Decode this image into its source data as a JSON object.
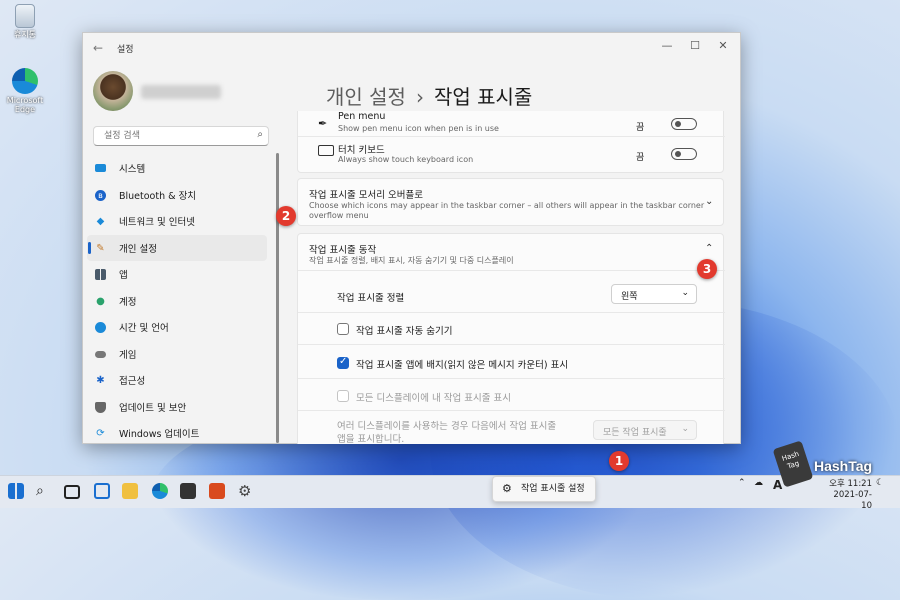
{
  "desktop": {
    "recycle_bin_label": "휴지통",
    "edge_label_line1": "Microsoft",
    "edge_label_line2": "Edge"
  },
  "window": {
    "title": "설정",
    "controls": {
      "minimize": "—",
      "maximize": "☐",
      "close": "✕"
    }
  },
  "sidebar": {
    "search_placeholder": "설정 검색",
    "items": [
      {
        "label": "시스템",
        "icon": "monitor-icon",
        "color": "#1a8ad8"
      },
      {
        "label": "Bluetooth & 장치",
        "icon": "bluetooth-icon",
        "color": "#1a63c9"
      },
      {
        "label": "네트워크 및 인터넷",
        "icon": "wifi-icon",
        "color": "#1a8ad8"
      },
      {
        "label": "개인 설정",
        "icon": "brush-icon",
        "color": "#c27a2c",
        "active": true
      },
      {
        "label": "앱",
        "icon": "apps-icon",
        "color": "#4a5a6a"
      },
      {
        "label": "계정",
        "icon": "person-icon",
        "color": "#2aa26c"
      },
      {
        "label": "시간 및 언어",
        "icon": "globe-icon",
        "color": "#1a8ad8"
      },
      {
        "label": "게임",
        "icon": "gamepad-icon",
        "color": "#777777"
      },
      {
        "label": "접근성",
        "icon": "accessibility-icon",
        "color": "#1a63c9"
      },
      {
        "label": "업데이트 및 보안",
        "icon": "shield-icon",
        "color": "#666666"
      },
      {
        "label": "Windows 업데이트",
        "icon": "update-icon",
        "color": "#1a8ad8"
      }
    ]
  },
  "breadcrumb": {
    "parent": "개인 설정",
    "separator": "›",
    "current": "작업 표시줄"
  },
  "content": {
    "pen_menu": {
      "title": "Pen menu",
      "subtitle": "Show pen menu icon when pen is in use",
      "state": "끔"
    },
    "touch_keyboard": {
      "title": "터치 키보드",
      "subtitle": "Always show touch keyboard icon",
      "state": "끔"
    },
    "overflow": {
      "title": "작업 표시줄 모서리 오버플로",
      "subtitle_line1": "Choose which icons may appear in the taskbar corner – all others will appear in the taskbar corner",
      "subtitle_line2": "overflow menu"
    },
    "behaviors": {
      "title": "작업 표시줄 동작",
      "subtitle": "작업 표시줄 정렬, 배지 표시, 자동 숨기기 및 다중 디스플레이",
      "alignment_label": "작업 표시줄 정렬",
      "alignment_value": "왼쪽",
      "auto_hide_label": "작업 표시줄 자동 숨기기",
      "badges_label": "작업 표시줄 앱에 배지(읽지 않은 메시지 카운터) 표시",
      "all_displays_label": "모든 디스플레이에 내 작업 표시줄 표시",
      "multi_display_line1": "여러 디스플레이를 사용하는 경우 다음에서 작업 표시줄",
      "multi_display_line2": "앱을 표시합니다.",
      "multi_display_value": "모든 작업 표시줄"
    }
  },
  "markers": [
    "1",
    "2",
    "3"
  ],
  "taskbar": {
    "tooltip": "작업 표시줄 설정",
    "ime": "A",
    "time": "오후 11:21",
    "date": "2021-07-10"
  },
  "watermark": {
    "line1": "Hash",
    "line2": "Tag",
    "brand": "HashTag"
  },
  "colors": {
    "accent": "#1a63c9",
    "marker": "#e23a2e"
  }
}
